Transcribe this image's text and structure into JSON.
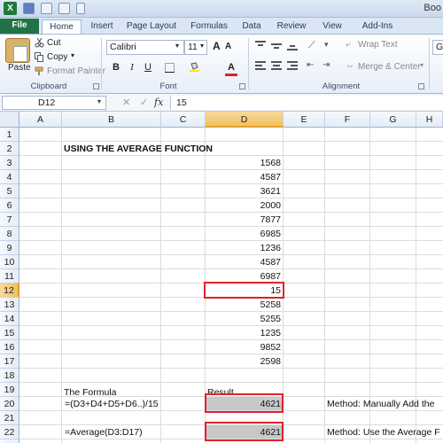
{
  "app": {
    "logo": "X",
    "title": "Boo"
  },
  "tabs": [
    "File",
    "Home",
    "Insert",
    "Page Layout",
    "Formulas",
    "Data",
    "Review",
    "View",
    "Add-Ins"
  ],
  "ribbon": {
    "clipboard": {
      "paste": "Paste",
      "cut": "Cut",
      "copy": "Copy",
      "format_painter": "Format Painter",
      "label": "Clipboard"
    },
    "font": {
      "name": "Calibri",
      "size": "11",
      "bold": "B",
      "italic": "I",
      "underline": "U",
      "font_color": "A",
      "label": "Font"
    },
    "alignment": {
      "wrap_text": "Wrap Text",
      "merge_center": "Merge & Center",
      "label": "Alignment"
    },
    "number_partial": "Ge"
  },
  "formula_bar": {
    "name_box": "D12",
    "fx": "fx",
    "value": "15"
  },
  "columns": [
    "A",
    "B",
    "C",
    "D",
    "E",
    "F",
    "G",
    "H"
  ],
  "rows": [
    "1",
    "2",
    "3",
    "4",
    "5",
    "6",
    "7",
    "8",
    "9",
    "10",
    "11",
    "12",
    "13",
    "14",
    "15",
    "16",
    "17",
    "18",
    "19",
    "20",
    "21",
    "22",
    "23"
  ],
  "cells": {
    "title": "USING THE AVERAGE FUNCTION",
    "values": [
      "1568",
      "4587",
      "3621",
      "2000",
      "7877",
      "6985",
      "1236",
      "4587",
      "6987",
      "15",
      "5258",
      "5255",
      "1235",
      "9852",
      "2598"
    ],
    "formula_header": "The Formula",
    "result_header": "Result",
    "formula_1": "=(D3+D4+D5+D6..)/15",
    "result_1": "4621",
    "method_1": "Method: Manually Add the",
    "formula_2": "=Average(D3:D17)",
    "result_2": "4621",
    "method_2": "Method: Use the Average F"
  }
}
